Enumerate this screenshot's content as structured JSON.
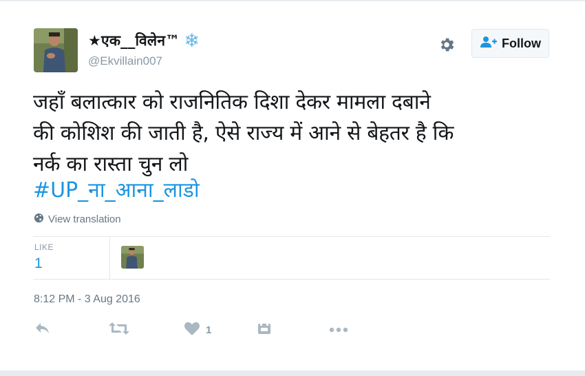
{
  "user": {
    "display_name": "★एक__विलेन™",
    "snowflake": "❄",
    "handle": "@Ekvillain007"
  },
  "follow_button": {
    "label": "Follow"
  },
  "tweet": {
    "text_lines": [
      "जहाँ बलात्कार को राजनितिक दिशा देकर मामला दबाने",
      "की कोशिश की जाती है, ऐसे राज्य में आने से बेहतर है कि",
      "नर्क का रास्ता चुन लो"
    ],
    "hashtag": "#UP_ना_आना_लाडो"
  },
  "view_translation": "View translation",
  "stats": {
    "like_label": "LIKE",
    "like_count": "1"
  },
  "timestamp": "8:12 PM - 3 Aug 2016",
  "actions": {
    "like_count": "1"
  },
  "icons": [
    "profile-avatar",
    "snowflake-icon",
    "gear-icon",
    "follow-person-icon",
    "globe-icon",
    "reply-icon",
    "retweet-icon",
    "heart-icon",
    "save-icon",
    "more-icon"
  ],
  "colors": {
    "link": "#1b95e0",
    "secondary": "#657786",
    "action_icon": "#aab8c2",
    "border": "#e1e8ed"
  }
}
